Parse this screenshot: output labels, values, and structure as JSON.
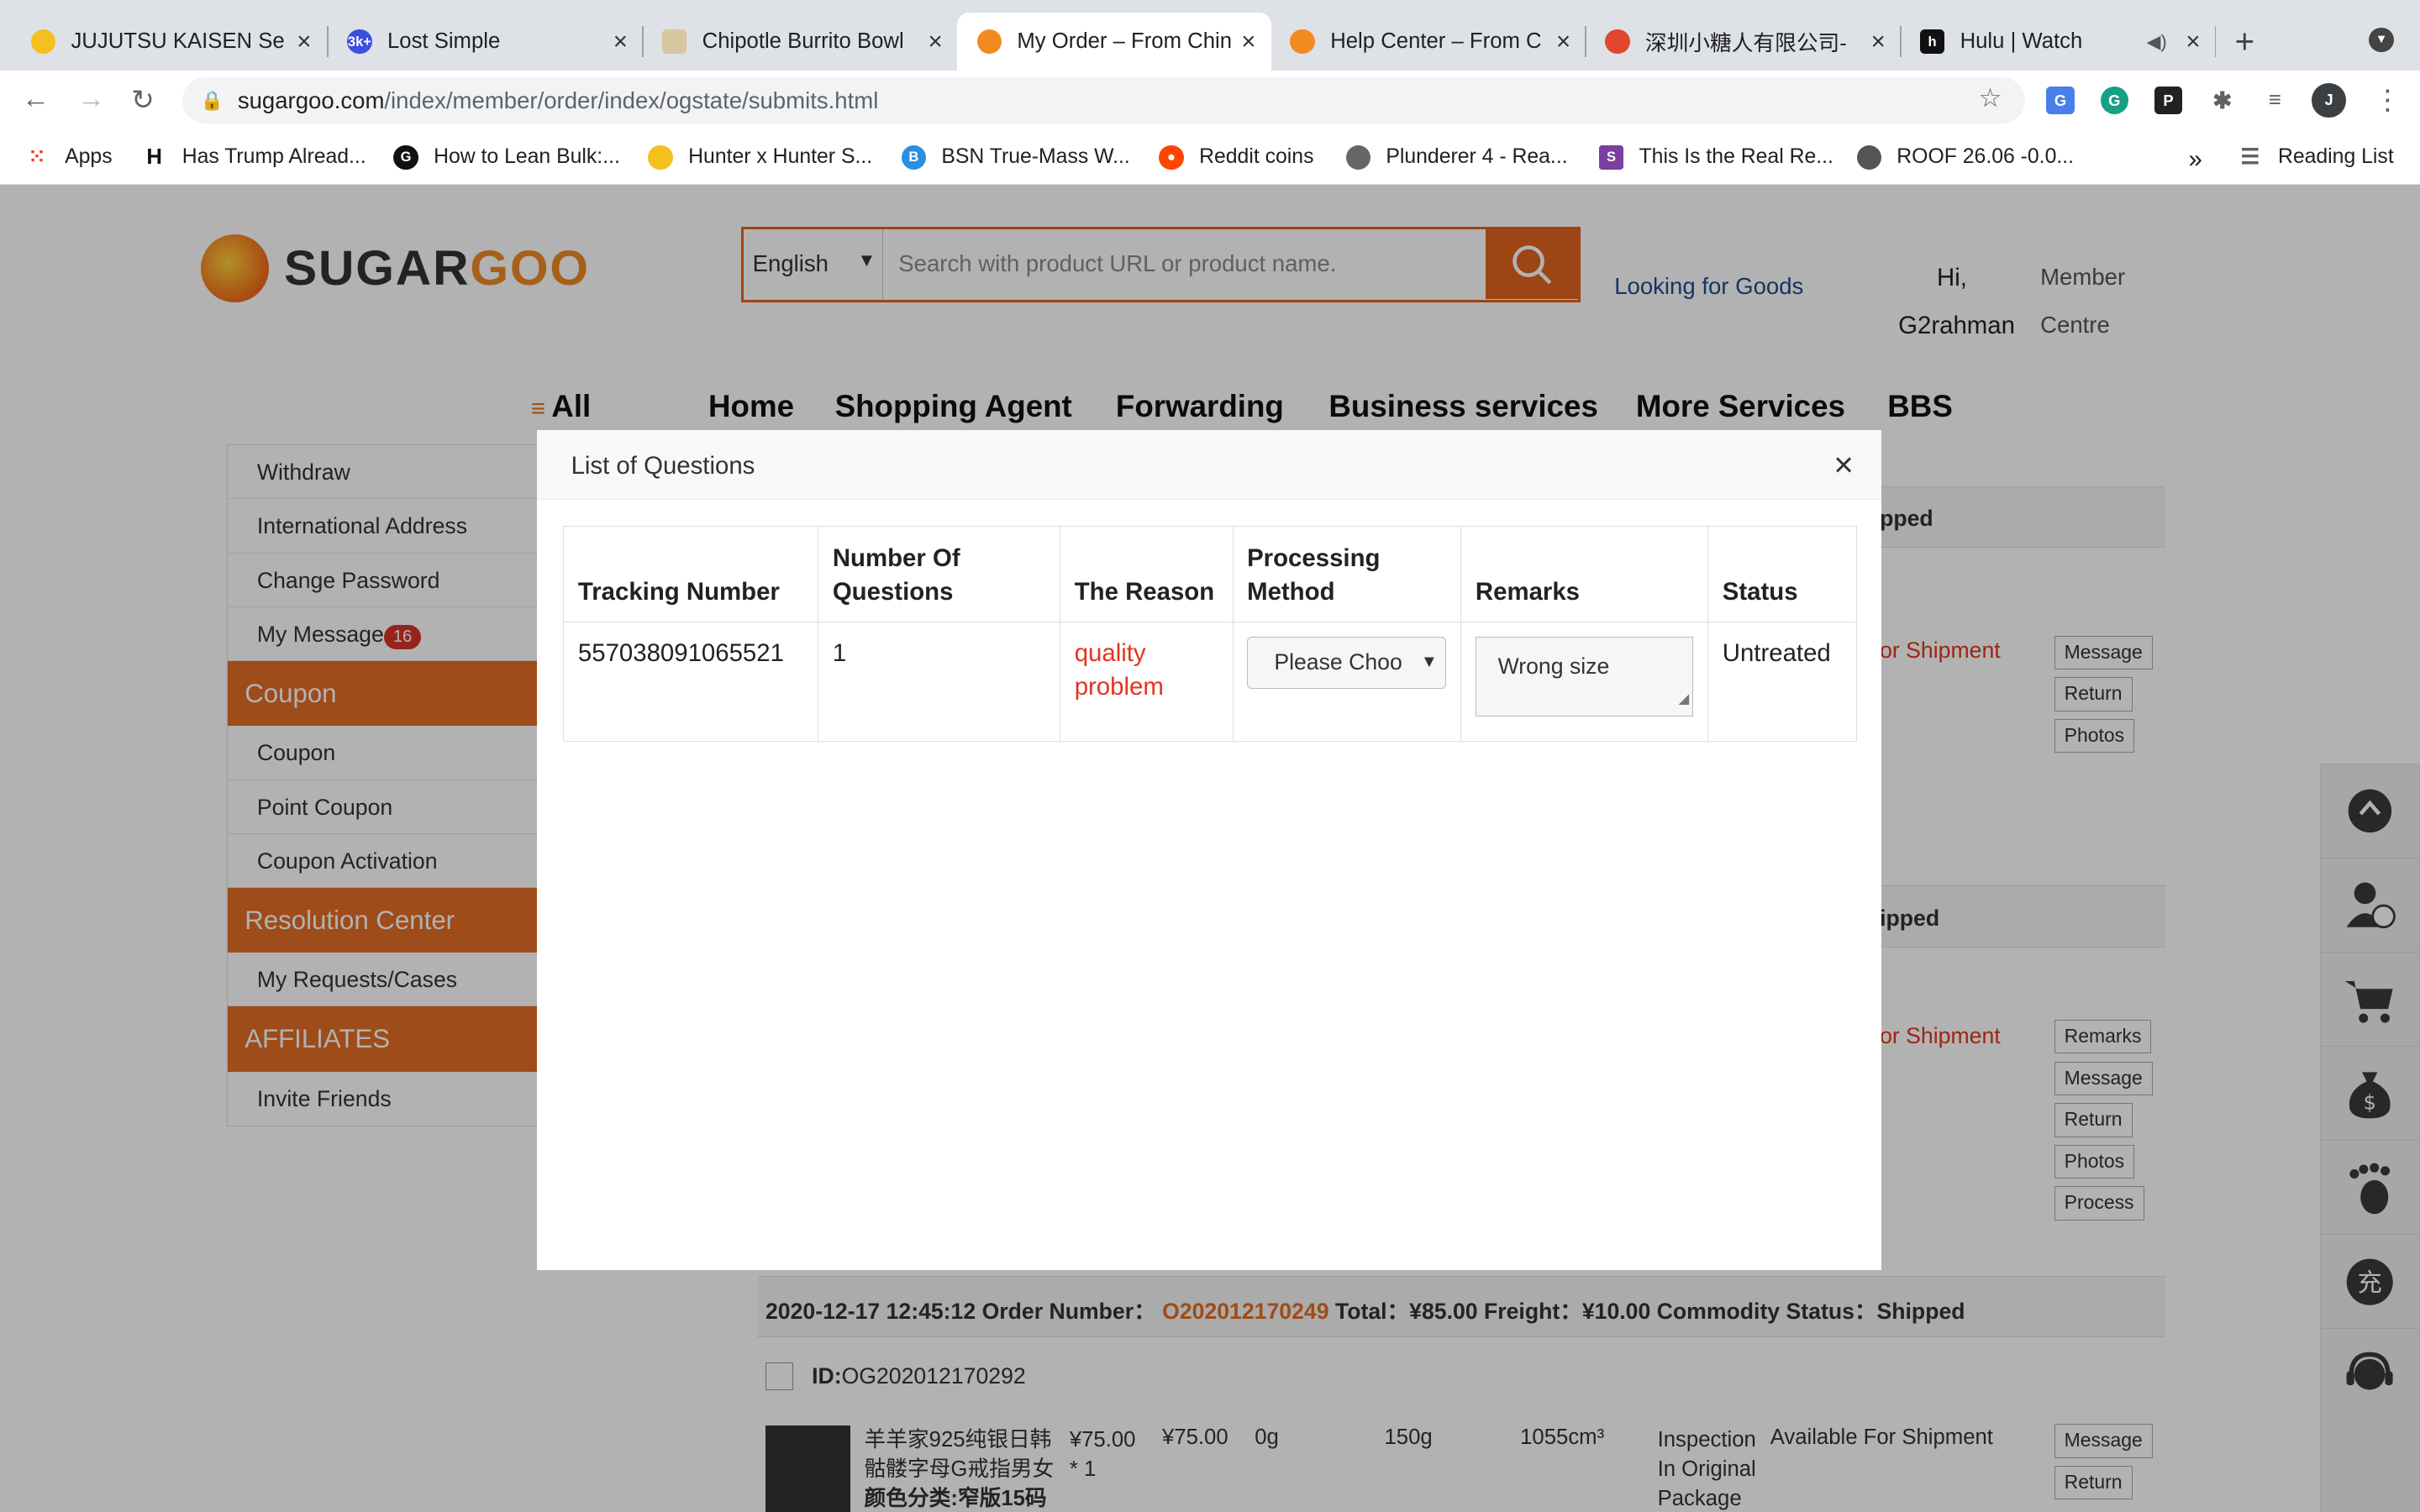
{
  "browser": {
    "tabs": [
      {
        "title": "JUJUTSU KAISEN Se",
        "icon_color": "#f4c01e",
        "close": "×"
      },
      {
        "title": "Lost Simple",
        "icon_color": "#3b4fe0",
        "icon_text": "3k+",
        "close": "×"
      },
      {
        "title": "Chipotle Burrito Bowl",
        "icon_color": "#d8c7a0",
        "close": "×"
      },
      {
        "title": "My Order – From Chin",
        "icon_color": "#f28a22",
        "close": "×",
        "active": true
      },
      {
        "title": "Help Center – From C",
        "icon_color": "#f28a22",
        "close": "×"
      },
      {
        "title": "深圳小糖人有限公司-",
        "icon_color": "#e2462c",
        "close": "×"
      },
      {
        "title": "Hulu | Watch",
        "icon_color": "#111111",
        "icon_text": "h",
        "close": "×"
      }
    ],
    "url_domain": "sugargoo.com",
    "url_path": "/index/member/order/index/ogstate/submits.html",
    "bookmarks": [
      "Apps",
      "Has Trump Alread...",
      "How to Lean Bulk:...",
      "Hunter x Hunter S...",
      "BSN True-Mass W...",
      "Reddit coins",
      "Plunderer 4 - Rea...",
      "This Is the Real Re...",
      "ROOF 26.06 -0.0..."
    ],
    "reading_list": "Reading List",
    "profile_initial": "J"
  },
  "site": {
    "logo_a": "SUGAR",
    "logo_b": "GOO",
    "lang": "English",
    "search_placeholder": "Search with product URL or product name.",
    "looking_for_goods": "Looking for Goods",
    "hi": "Hi,",
    "username": "G2rahman",
    "member": "Member",
    "centre": "Centre",
    "nav": [
      "All",
      "Home",
      "Shopping Agent",
      "Forwarding",
      "Business services",
      "More Services",
      "BBS"
    ]
  },
  "sidebar": {
    "items_a": [
      "Withdraw",
      "International Address",
      "Change Password",
      "My Message"
    ],
    "message_count": "16",
    "coupon_header": "Coupon",
    "items_b": [
      "Coupon",
      "Point Coupon",
      "Coupon Activation"
    ],
    "resolution_header": "Resolution Center",
    "items_c": [
      "My Requests/Cases"
    ],
    "affiliates_header": "AFFILIATES",
    "items_d": [
      "Invite Friends"
    ]
  },
  "orders": {
    "shipped_1": "pped",
    "shipped_2": "ipped",
    "for_shipment_1": "or Shipment",
    "for_shipment_2": "or Shipment",
    "actions_1": [
      "Message",
      "Return",
      "Photos"
    ],
    "actions_2": [
      "Remarks",
      "Message",
      "Return",
      "Photos",
      "Process"
    ],
    "order_date": "2020-12-17 12:45:12 Order Number：",
    "order_number": "O202012170249",
    "order_rest": "Total：¥85.00 Freight：¥10.00 Commodity Status：Shipped",
    "id_label": "ID:",
    "id_value": "OG202012170292",
    "item_name_1": "羊羊家925纯银日韩",
    "item_name_2": "骷髅字母G戒指男女",
    "item_name_3": "颜色分类:窄版15码",
    "price": "¥75.00",
    "price2": "¥75.00",
    "qty": "* 1",
    "weight": "0g",
    "weight2": "150g",
    "volume": "1055cm³",
    "inspection_1": "Inspection",
    "inspection_2": "In Original",
    "inspection_3": "Package",
    "available": "Available For Shipment",
    "actions_3": [
      "Message",
      "Return"
    ]
  },
  "modal": {
    "title": "List of Questions",
    "close": "×",
    "headers": [
      "Tracking Number",
      "Number Of Questions",
      "The Reason",
      "Processing Method",
      "Remarks",
      "Status"
    ],
    "row": {
      "tracking": "557038091065521",
      "count": "1",
      "reason": "quality problem",
      "method": "Please Choo",
      "remarks": "Wrong size",
      "status": "Untreated"
    }
  }
}
